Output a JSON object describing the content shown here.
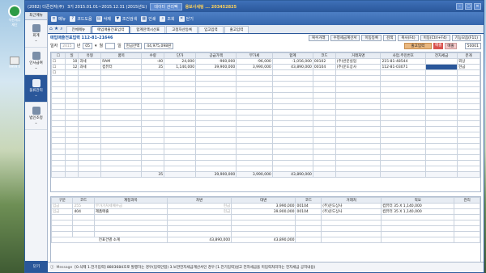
{
  "desktop": {
    "logo_label": "식한세무\n재단",
    "file_label": "9999 II"
  },
  "titlebar": {
    "program": "(2082) 더존전자(주)",
    "period": "3기 2015.01.01~2015.12.31 (2015년도)",
    "btn1": "데이터 관리팩",
    "company": "용보사세팅 ... 203452825"
  },
  "sidebar": {
    "header": "최근메뉴",
    "items": [
      {
        "label": "회계"
      },
      {
        "label": "인사급여"
      },
      {
        "label": "물류관리"
      },
      {
        "label": "법인조정"
      }
    ],
    "bottom": "닫기"
  },
  "toolbar": {
    "items": [
      "메뉴",
      "코드도움",
      "삭제",
      "조건검색",
      "인쇄",
      "조회",
      "닫기"
    ]
  },
  "tabs": {
    "items": [
      "전체메뉴",
      "매입매출전표입력",
      "합계잔액시산표",
      "고정자산등록",
      "입고입력",
      "출고입력"
    ],
    "active_index": 1
  },
  "form": {
    "title": "매입매출전표입력 112-81-21646",
    "buttons": [
      "복수거래",
      "수정세금계산서",
      "이동등록",
      "검색",
      "복사(F4)",
      "이동(Ctrl+F4)",
      "기능모음(F11)"
    ]
  },
  "filter": {
    "date_label": "일자",
    "year": "2015",
    "year_suffix": "년",
    "month": "05",
    "month_suffix": "월",
    "day_suffix": "일",
    "cash_label": "현금잔액",
    "cash_value": "44,975,098원",
    "btn_orange": "출고입력",
    "btn_red": "매출",
    "btn_pink": "매출",
    "code_value": "50001"
  },
  "grid1": {
    "headers": [
      "",
      "일",
      "유형",
      "품목",
      "수량",
      "단가",
      "공급가액",
      "부가세",
      "합계",
      "코드",
      "거래처명",
      "사업.주민번호",
      "전자세금",
      "분개"
    ],
    "rows": [
      [
        "",
        "10",
        "과세",
        "RAM",
        "-40",
        "24,000",
        "-960,000",
        "-96,000",
        "-1,056,000",
        "00102",
        "(주)반문실업",
        "215-81-48544",
        "",
        "외상"
      ],
      [
        "",
        "12",
        "과세",
        "컴퓨터",
        "35",
        "1,140,000",
        "39,900,000",
        "3,990,000",
        "43,890,000",
        "00104",
        "(주)운도상사",
        "112-81-03071",
        "",
        "현금"
      ]
    ],
    "totals": [
      "",
      "",
      "",
      "",
      "35",
      "",
      "39,900,000",
      "3,990,000",
      "43,890,000",
      "",
      "",
      "",
      "",
      ""
    ]
  },
  "grid2": {
    "headers": [
      "구분",
      "코드",
      "계정과목",
      "차변",
      "대변",
      "코드",
      "거래처",
      "적요",
      "관리"
    ],
    "rows": [
      [
        "입금",
        "255",
        "부가가치세예수금",
        "현금",
        "3,990,000",
        "00104",
        "(주)운도상사",
        "컴퓨터 35 X 1,140,000",
        ""
      ],
      [
        "입금",
        "404",
        "제품매출",
        "현금",
        "39,900,000",
        "00104",
        "(주)운도상사",
        "컴퓨터 35 X 1,140,000",
        ""
      ]
    ],
    "total_label": "전표건별 소계",
    "total_debit": "43,890,000",
    "total_credit": "43,890,000"
  },
  "message": {
    "label": "Message",
    "text": "[0.삭제 1.전기입력] 8803684호로 발행하는 경우(입력안함) 3.보관전자세금계산서인 경우 [1.전기입력]설고 전자세금을 미입력처리하는 전자세금 공지내용)"
  }
}
